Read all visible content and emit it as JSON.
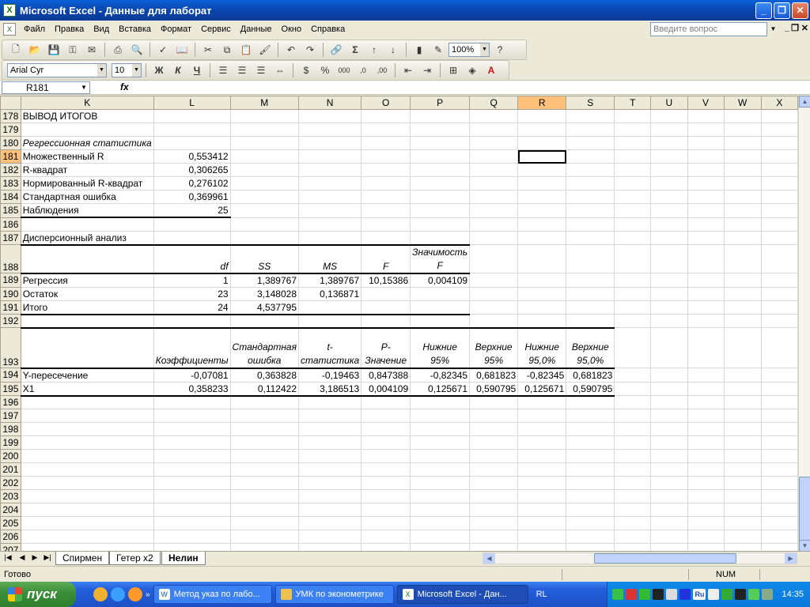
{
  "window": {
    "title": "Microsoft Excel - Данные для лаборат",
    "icon": "excel-icon"
  },
  "menu": {
    "items": [
      "Файл",
      "Правка",
      "Вид",
      "Вставка",
      "Формат",
      "Сервис",
      "Данные",
      "Окно",
      "Справка"
    ],
    "ask_placeholder": "Введите вопрос"
  },
  "toolbar": {
    "zoom": "100%",
    "font": "Arial Cyr",
    "size": "10",
    "bold": "Ж",
    "italic": "К",
    "underline": "Ч",
    "percent": "%",
    "thousands": "000",
    "sum": "Σ"
  },
  "formula_bar": {
    "cell_ref": "R181",
    "fx": "fx",
    "content": ""
  },
  "sheet": {
    "columns": [
      "K",
      "L",
      "M",
      "N",
      "O",
      "P",
      "Q",
      "R",
      "S",
      "T",
      "U",
      "V",
      "W",
      "X"
    ],
    "selected_column": "R",
    "selected_row": "181",
    "rows": [
      {
        "n": "178",
        "K": "ВЫВОД ИТОГОВ"
      },
      {
        "n": "179"
      },
      {
        "n": "180",
        "K": "Регрессионная статистика"
      },
      {
        "n": "181",
        "K": "Множественный R",
        "L": "0,553412"
      },
      {
        "n": "182",
        "K": "R-квадрат",
        "L": "0,306265"
      },
      {
        "n": "183",
        "K": "Нормированный R-квадрат",
        "L": "0,276102"
      },
      {
        "n": "184",
        "K": "Стандартная ошибка",
        "L": "0,369961"
      },
      {
        "n": "185",
        "K": "Наблюдения",
        "L": "25"
      },
      {
        "n": "186"
      },
      {
        "n": "187",
        "K": "Дисперсионный анализ"
      },
      {
        "n": "188",
        "L": "df",
        "M": "SS",
        "N": "MS",
        "O": "F",
        "P": "Значимость F"
      },
      {
        "n": "189",
        "K": "Регрессия",
        "L": "1",
        "M": "1,389767",
        "N": "1,389767",
        "O": "10,15386",
        "P": "0,004109"
      },
      {
        "n": "190",
        "K": "Остаток",
        "L": "23",
        "M": "3,148028",
        "N": "0,136871"
      },
      {
        "n": "191",
        "K": "Итого",
        "L": "24",
        "M": "4,537795"
      },
      {
        "n": "192"
      },
      {
        "n": "193",
        "L": "Коэффициенты",
        "M": "Стандартная ошибка",
        "N": "t-статистика",
        "O": "P-Значение",
        "P": "Нижние 95%",
        "Q": "Верхние 95%",
        "R": "Нижние 95,0%",
        "S": "Верхние 95,0%"
      },
      {
        "n": "194",
        "K": "Y-пересечение",
        "L": "-0,07081",
        "M": "0,363828",
        "N": "-0,19463",
        "O": "0,847388",
        "P": "-0,82345",
        "Q": "0,681823",
        "R": "-0,82345",
        "S": "0,681823"
      },
      {
        "n": "195",
        "K": "X1",
        "L": "0,358233",
        "M": "0,112422",
        "N": "3,186513",
        "O": "0,004109",
        "P": "0,125671",
        "Q": "0,590795",
        "R": "0,125671",
        "S": "0,590795"
      },
      {
        "n": "196"
      },
      {
        "n": "197"
      },
      {
        "n": "198"
      },
      {
        "n": "199"
      },
      {
        "n": "200"
      },
      {
        "n": "201"
      },
      {
        "n": "202"
      },
      {
        "n": "203"
      },
      {
        "n": "204"
      },
      {
        "n": "205"
      },
      {
        "n": "206"
      },
      {
        "n": "207"
      }
    ]
  },
  "sheet_tabs": [
    "Спирмен",
    "Гетер x2",
    "Нелин"
  ],
  "active_tab": "Нелин",
  "status": {
    "ready": "Готово",
    "num": "NUM"
  },
  "taskbar": {
    "start": "пуск",
    "tasks": [
      "Метод указ по лабо...",
      "УМК по эконометрике",
      "Microsoft Excel - Дан..."
    ],
    "language": "RL",
    "tray_lang": "Ru",
    "clock": "14:35"
  },
  "colors": {
    "title_blue": "#0a5fd8",
    "selected_header": "#ffc07a",
    "taskbar_blue": "#245edb",
    "start_green": "#3c8f3b"
  }
}
